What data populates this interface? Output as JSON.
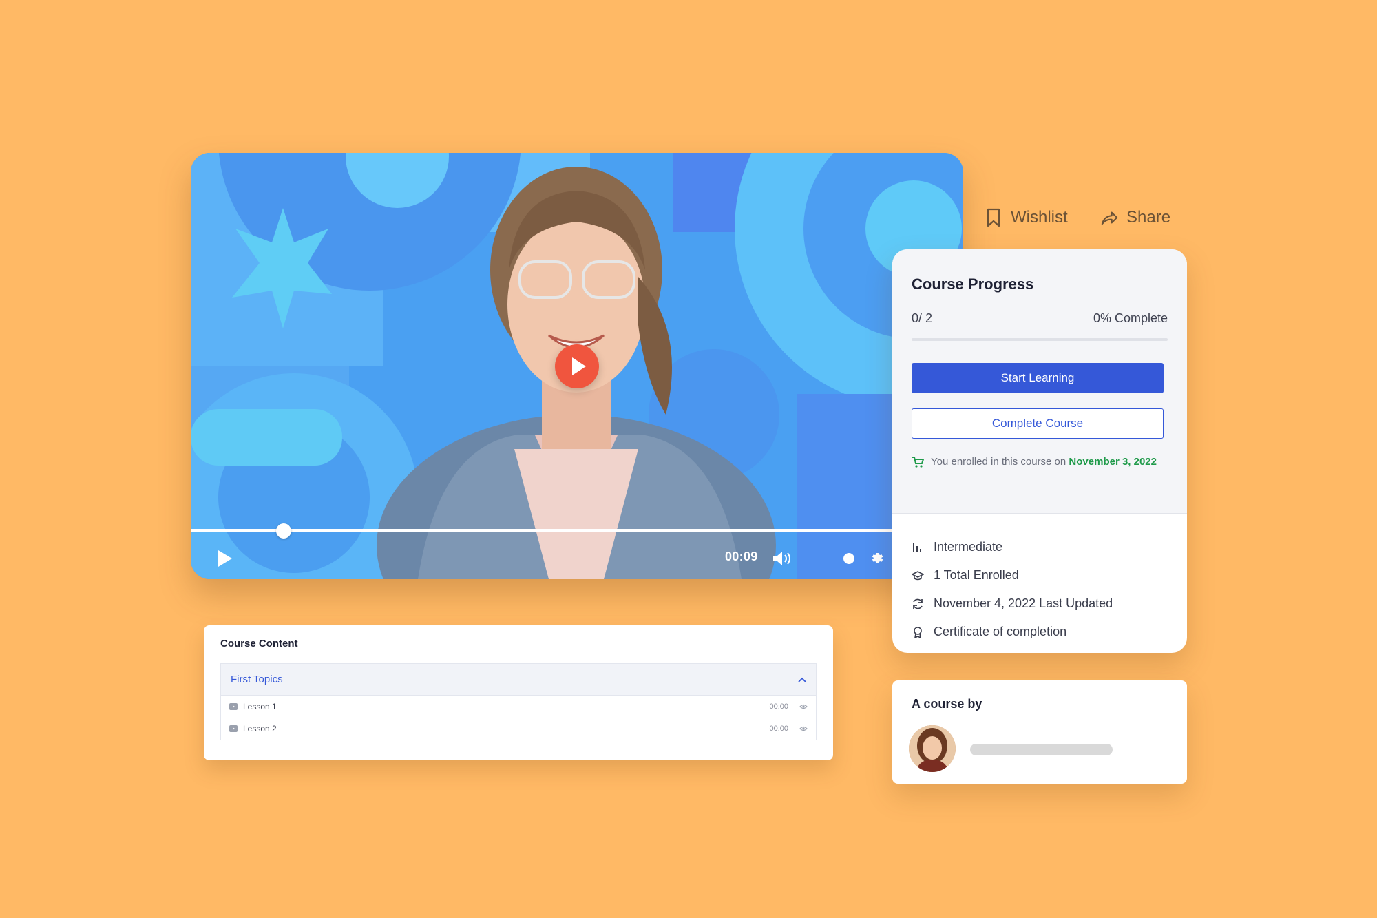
{
  "colors": {
    "background": "#FFB965",
    "accent": "#3558d8",
    "play_button": "#f0553e",
    "success": "#1f9a4a"
  },
  "player": {
    "time": "00:09",
    "icons": [
      "play-icon",
      "volume-icon",
      "quality-dot-icon",
      "gear-icon"
    ]
  },
  "actions": {
    "wishlist": "Wishlist",
    "share": "Share"
  },
  "progress": {
    "title": "Course Progress",
    "count": "0/ 2",
    "percent_label": "0% Complete",
    "fraction": 0,
    "start_button": "Start Learning",
    "complete_button": "Complete Course",
    "enrolled_text": "You enrolled in this course on",
    "enrolled_date": "November 3, 2022"
  },
  "meta": {
    "level": "Intermediate",
    "enrolled": "1 Total Enrolled",
    "updated": "November 4, 2022 Last Updated",
    "certificate": "Certificate of completion"
  },
  "author": {
    "title": "A course by"
  },
  "content": {
    "title": "Course Content",
    "topic": "First Topics",
    "lessons": [
      {
        "label": "Lesson 1",
        "duration": "00:00"
      },
      {
        "label": "Lesson 2",
        "duration": "00:00"
      }
    ]
  }
}
